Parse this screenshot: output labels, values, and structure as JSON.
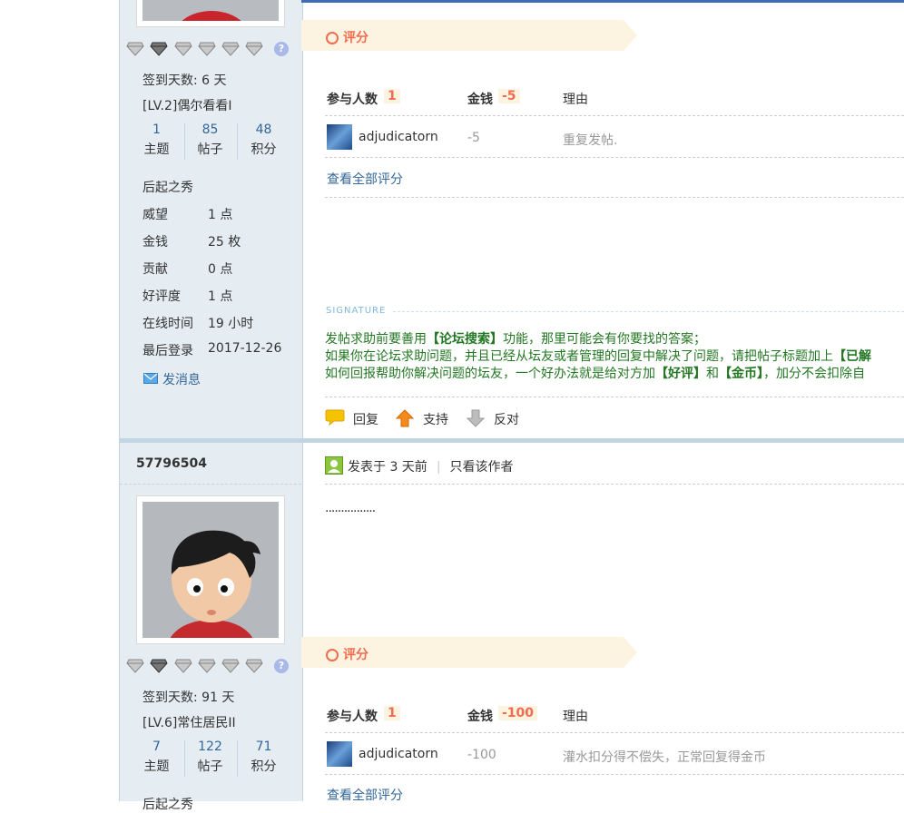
{
  "post1": {
    "sidebar": {
      "checkin": "签到天数: 6 天",
      "level": "[LV.2]偶尔看看I",
      "stats": [
        {
          "num": "1",
          "label": "主题"
        },
        {
          "num": "85",
          "label": "帖子"
        },
        {
          "num": "48",
          "label": "积分"
        }
      ],
      "rank": "后起之秀",
      "fields": [
        {
          "label": "威望",
          "value": "1 点"
        },
        {
          "label": "金钱",
          "value": "25 枚"
        },
        {
          "label": "贡献",
          "value": "0 点"
        },
        {
          "label": "好评度",
          "value": "1 点"
        },
        {
          "label": "在线时间",
          "value": "19 小时"
        },
        {
          "label": "最后登录",
          "value": "2017-12-26"
        }
      ],
      "message_label": "发消息"
    },
    "rating": {
      "title": "评分",
      "participants_label": "参与人数",
      "participants_count": "1",
      "money_label": "金钱",
      "money_total": "-5",
      "reason_label": "理由",
      "entries": [
        {
          "user": "adjudicatorn",
          "money": "-5",
          "reason": "重复发帖."
        }
      ],
      "view_all": "查看全部评分"
    },
    "signature": {
      "label": "SIGNATURE",
      "line1": {
        "pre": "发帖求助前要善用",
        "bold1": "【论坛搜索】",
        "post": "功能，那里可能会有你要找的答案；"
      },
      "line2": {
        "pre": "如果你在论坛求助问题，并且已经从坛友或者管理的回复中解决了问题，请把帖子标题加上",
        "bold1": "【已解"
      },
      "line3": {
        "pre": "如何回报帮助你解决问题的坛友，一个好办法就是给对方加",
        "bold1": "【好评】",
        "mid": "和",
        "bold2": "【金币】",
        "post": "，加分不会扣除自"
      }
    },
    "actions": {
      "reply": "回复",
      "support": "支持",
      "oppose": "反对"
    }
  },
  "post2": {
    "username": "57796504",
    "meta": {
      "posted": "发表于 3 天前",
      "only_author": "只看该作者"
    },
    "content": "................",
    "sidebar": {
      "checkin": "签到天数: 91 天",
      "level": "[LV.6]常住居民II",
      "stats": [
        {
          "num": "7",
          "label": "主题"
        },
        {
          "num": "122",
          "label": "帖子"
        },
        {
          "num": "71",
          "label": "积分"
        }
      ],
      "rank": "后起之秀"
    },
    "rating": {
      "title": "评分",
      "participants_label": "参与人数",
      "participants_count": "1",
      "money_label": "金钱",
      "money_total": "-100",
      "reason_label": "理由",
      "entries": [
        {
          "user": "adjudicatorn",
          "money": "-100",
          "reason": "灌水扣分得不偿失，正常回复得金币"
        }
      ],
      "view_all": "查看全部评分"
    }
  },
  "help_glyph": "?",
  "colors": {
    "accent": "#f26c4f",
    "link": "#336699",
    "signature": "#227722",
    "sidebar": "#e5edf2"
  }
}
